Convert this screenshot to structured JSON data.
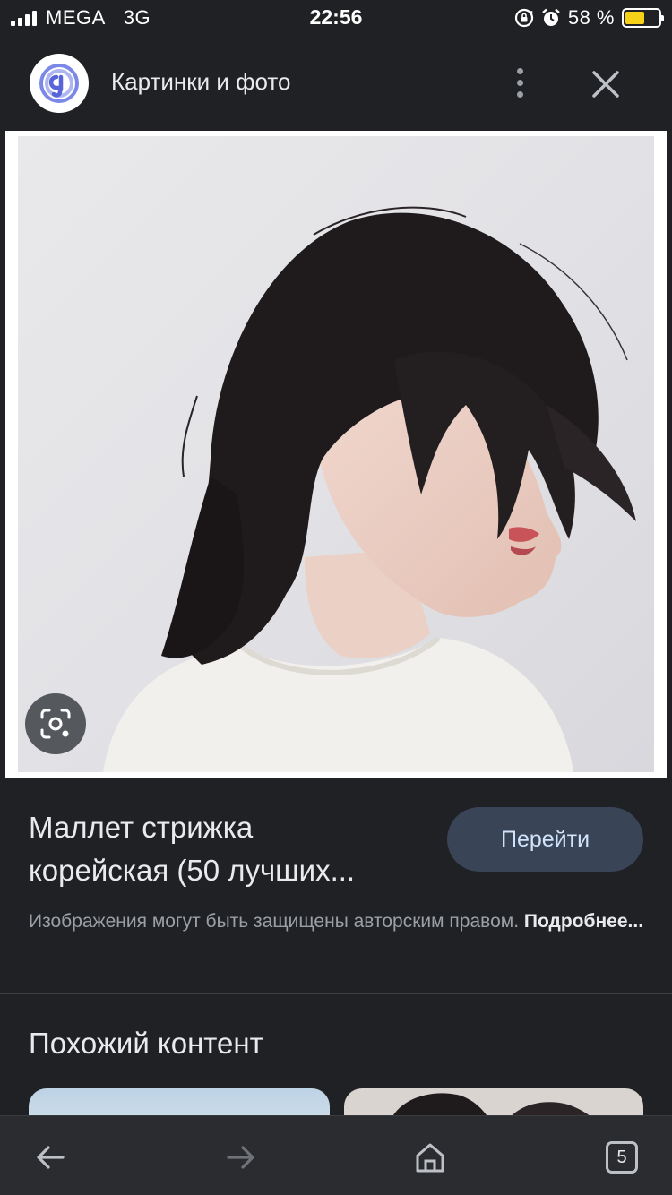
{
  "status_bar": {
    "carrier": "MEGA",
    "network": "3G",
    "time": "22:56",
    "battery_percent": "58 %",
    "battery_level": 0.58,
    "battery_color": "#f7d117",
    "icons": [
      "signal-icon",
      "orientation-lock-icon",
      "alarm-icon",
      "battery-icon"
    ]
  },
  "header": {
    "title": "Картинки и фото",
    "logo_icon": "google-lens-logo-icon",
    "menu_icon": "more-vert-icon",
    "close_icon": "close-icon"
  },
  "image": {
    "lens_icon": "lens-search-icon"
  },
  "result": {
    "title_line1": "Маллет стрижка",
    "title_line2": "корейская (50 лучших...",
    "go_button": "Перейти",
    "copyright_text": "Изображения могут быть защищены авторским правом.",
    "more_link": "Подробнее..."
  },
  "similar": {
    "title": "Похожий контент"
  },
  "bottom_bar": {
    "back_icon": "arrow-back-icon",
    "forward_icon": "arrow-forward-icon",
    "home_icon": "home-icon",
    "tabs_count": "5"
  },
  "colors": {
    "background": "#202124",
    "button_bg": "#394457",
    "button_text": "#d2e3fc",
    "muted_text": "#9aa0a6"
  }
}
